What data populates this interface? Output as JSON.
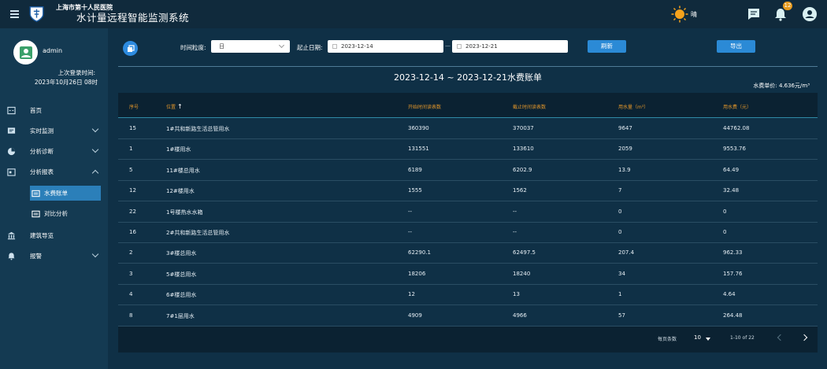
{
  "header": {
    "hospital": "上海市第十人民医院",
    "system_title": "水计量远程智能监测系统",
    "weather_label": "晴",
    "notification_count": "12"
  },
  "user": {
    "name": "admin",
    "last_login_label": "上次登录时间:",
    "last_login_time": "2023年10月26日 08时"
  },
  "sidebar": {
    "items": [
      {
        "label": "首页"
      },
      {
        "label": "实时监测"
      },
      {
        "label": "分析诊断"
      },
      {
        "label": "分析报表"
      },
      {
        "label": "建筑导览"
      },
      {
        "label": "报警"
      }
    ],
    "sub_items": [
      {
        "label": "水费账单"
      },
      {
        "label": "对比分析"
      }
    ]
  },
  "filters": {
    "granularity_label": "时间粒度:",
    "granularity_value": "日",
    "date_range_label": "起止日期:",
    "start_date": "2023-12-14",
    "range_separator": "—",
    "end_date": "2023-12-21",
    "refresh_label": "刷新",
    "export_label": "导出"
  },
  "bill": {
    "title": "2023-12-14 ~ 2023-12-21水费账单",
    "unit_price": "水费单价: 4.636元/m³"
  },
  "table": {
    "headers": [
      "序号",
      "位置",
      "开始时间读表数",
      "截止时间读表数",
      "用水量（m³）",
      "用水费（元）"
    ],
    "rows": [
      [
        "15",
        "1#共和新路生活总管用水",
        "360390",
        "370037",
        "9647",
        "44762.08"
      ],
      [
        "1",
        "1#楼用水",
        "131551",
        "133610",
        "2059",
        "9553.76"
      ],
      [
        "5",
        "11#楼总用水",
        "6189",
        "6202.9",
        "13.9",
        "64.49"
      ],
      [
        "12",
        "12#楼用水",
        "1555",
        "1562",
        "7",
        "32.48"
      ],
      [
        "22",
        "1号楼热水水箱",
        "--",
        "--",
        "0",
        "0"
      ],
      [
        "16",
        "2#共和新路生活总管用水",
        "--",
        "--",
        "0",
        "0"
      ],
      [
        "2",
        "3#楼总用水",
        "62290.1",
        "62497.5",
        "207.4",
        "962.33"
      ],
      [
        "3",
        "5#楼总用水",
        "18206",
        "18240",
        "34",
        "157.76"
      ],
      [
        "4",
        "6#楼总用水",
        "12",
        "13",
        "1",
        "4.64"
      ],
      [
        "8",
        "7#1层用水",
        "4909",
        "4966",
        "57",
        "264.48"
      ]
    ]
  },
  "pagination": {
    "rows_per_page_label": "每页条数",
    "rows_per_page": "10",
    "range_text": "1-10 of 22"
  },
  "colors": {
    "accent": "#2b8ad6",
    "header_text": "#e2962a",
    "badge": "#e69a1e"
  }
}
